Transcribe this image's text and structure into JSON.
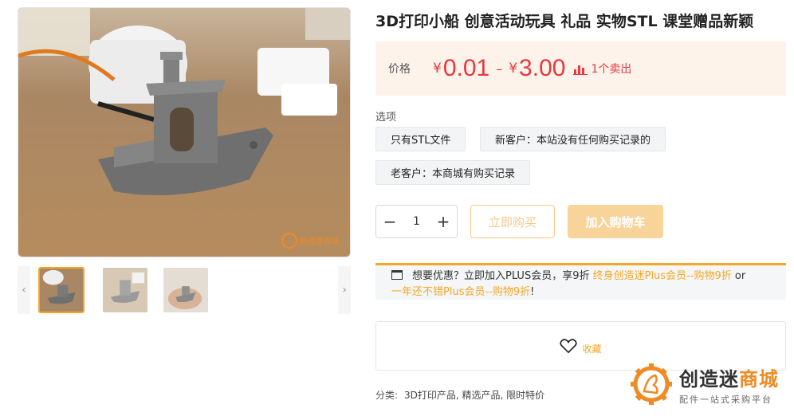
{
  "product": {
    "title": "3D打印小船 创意活动玩具 礼品 实物STL 课堂赠品新颖"
  },
  "price": {
    "label": "价格",
    "currency": "¥",
    "min": "0.01",
    "separator": "–",
    "max": "3.00",
    "sold_text": "1个卖出"
  },
  "options": {
    "label": "选项",
    "items": [
      "只有STL文件",
      "新客户：本站没有任何购买记录的",
      "老客户：本商城有购买记录"
    ]
  },
  "quantity": {
    "minus": "−",
    "value": "1",
    "plus": "+"
  },
  "buttons": {
    "buy_now": "立即购买",
    "add_to_cart": "加入购物车"
  },
  "plus_promo": {
    "text_before": "想要优惠？立即加入PLUS会员，享9折 ",
    "link1": "终身创造迷Plus会员--购物9折",
    "or": " or",
    "link2": "一年还不错Plus会员--购物9折",
    "end": "!"
  },
  "favorite": {
    "label": "收藏"
  },
  "category": {
    "label": "分类:",
    "value": "3D打印产品, 精选产品, 限时特价"
  },
  "gallery": {
    "prev": "‹",
    "next": "›",
    "watermark": "创造迷商城"
  },
  "logo": {
    "main_black": "创造迷",
    "main_orange": "商城",
    "sub": "配件一站式采购平台"
  },
  "colors": {
    "accent": "#f5a623",
    "price": "#e5393d",
    "price_bg": "#fdf3ea"
  }
}
